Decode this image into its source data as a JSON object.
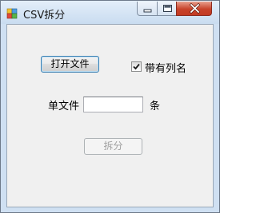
{
  "window": {
    "title": "CSV拆分",
    "icon": "csv-app-icon",
    "controls": {
      "minimize_icon": "minimize-icon",
      "maximize_icon": "maximize-icon",
      "close_icon": "close-icon"
    }
  },
  "form": {
    "open_file_button": "打开文件",
    "has_header_checkbox": {
      "label": "带有列名",
      "checked": true
    },
    "rows_per_file": {
      "label": "单文件",
      "value": "",
      "placeholder": "",
      "unit": "条"
    },
    "split_button": {
      "label": "拆分",
      "enabled": false
    }
  },
  "colors": {
    "close_button": "#c8432b",
    "focus_border": "#3c7fb1",
    "client_background": "#f0f0f0"
  }
}
